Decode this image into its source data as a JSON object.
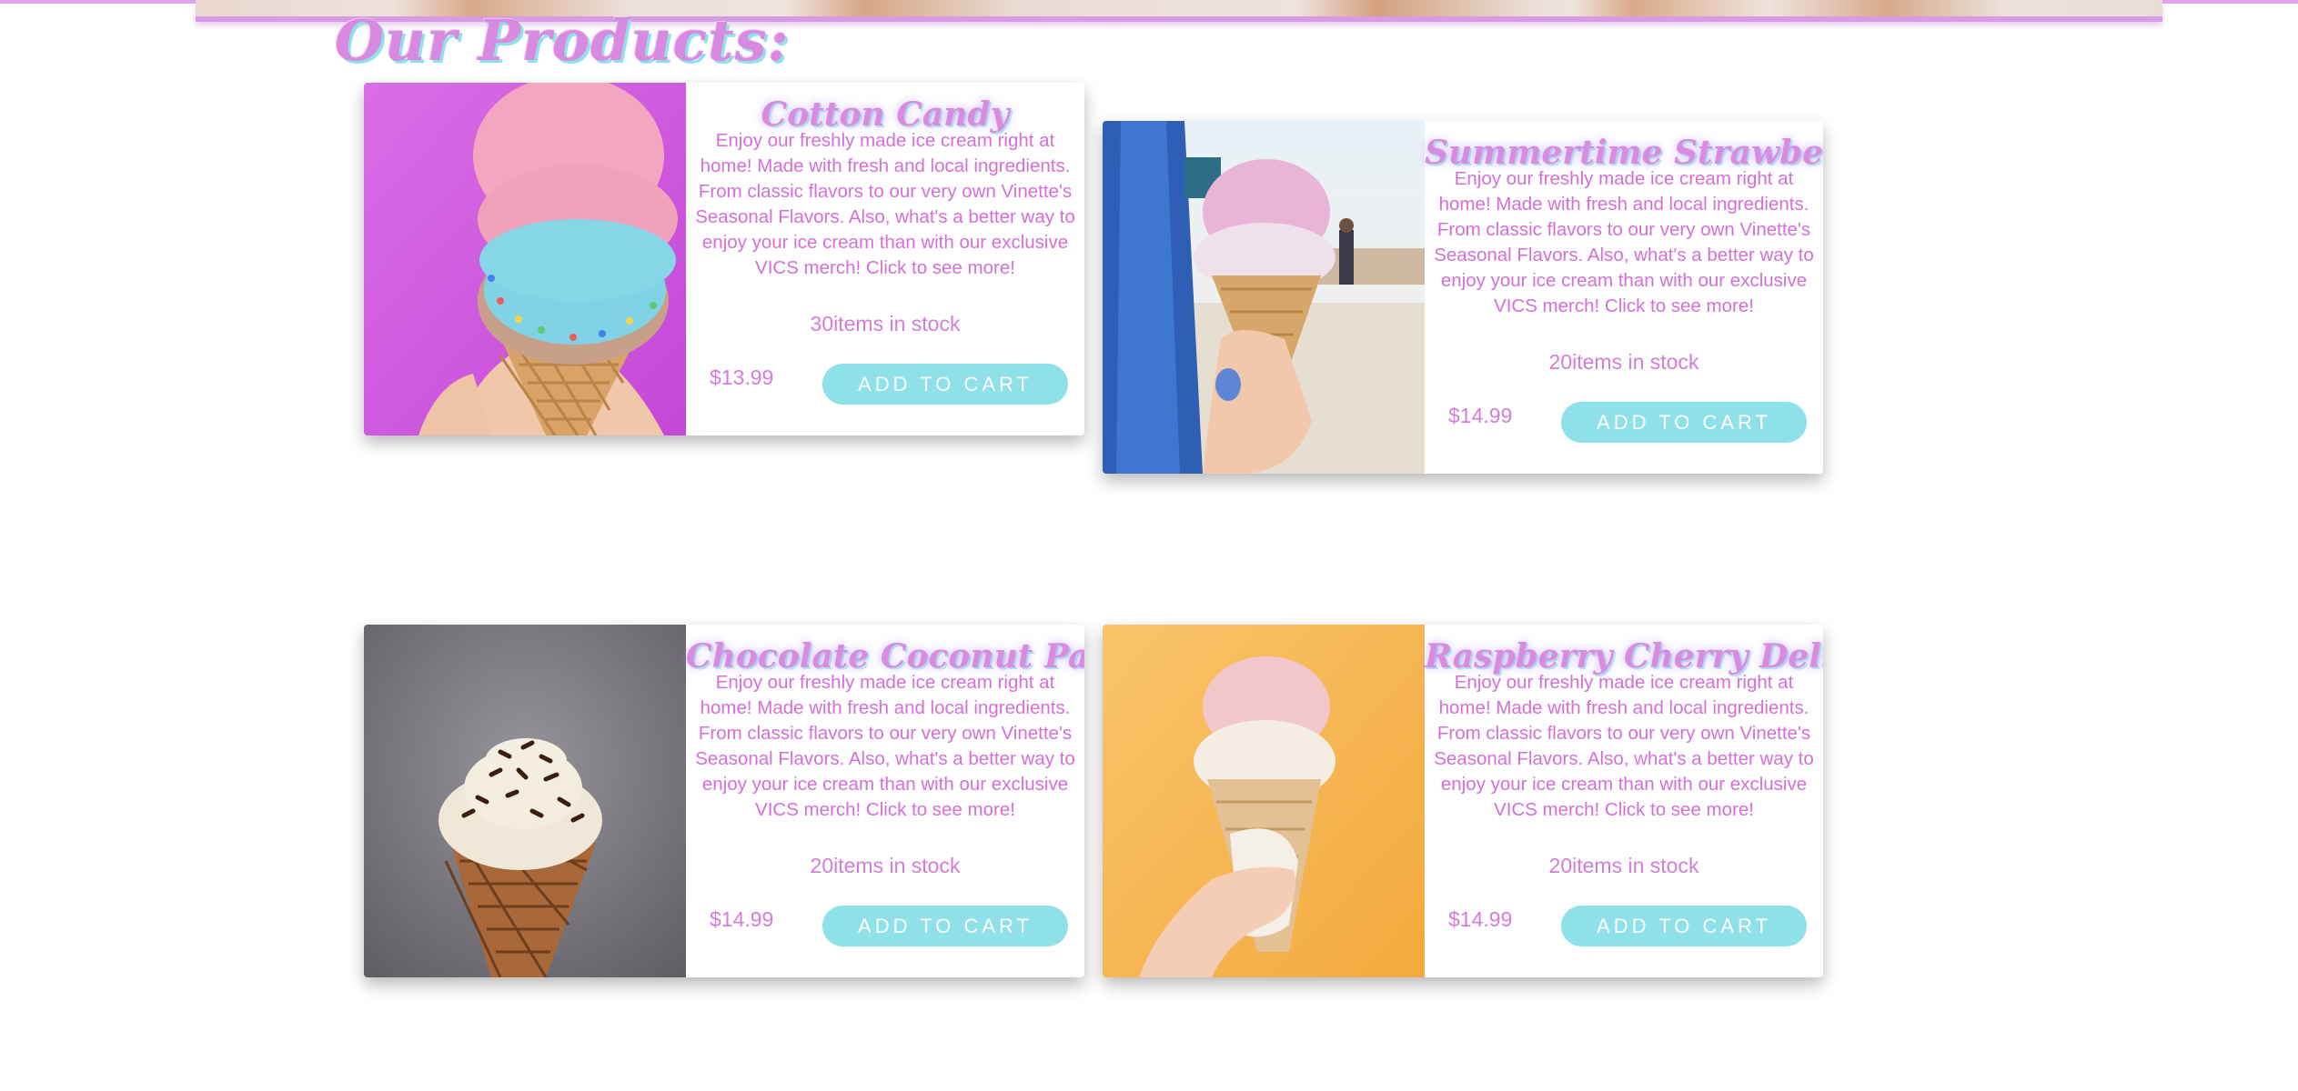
{
  "section": {
    "title": "Our Products:"
  },
  "colors": {
    "accent_pink": "#d98be0",
    "accent_cyan": "#8ee1e8",
    "text_pink": "#d46fd8"
  },
  "products": [
    {
      "name": "Cotton Candy",
      "description": "Enjoy our freshly made ice cream right at home! Made with fresh and local ingredients. From classic flavors to our very own Vinette's Seasonal Flavors. Also, what's a better way to enjoy your ice cream than with our exclusive VICS merch! Click to see more!",
      "stock": "30items in stock",
      "price": "$13.99",
      "button": "ADD TO CART",
      "image": "pink-and-blue-ice-cream-cone-photo"
    },
    {
      "name": "Summertime Strawberry",
      "description": "Enjoy our freshly made ice cream right at home! Made with fresh and local ingredients. From classic flavors to our very own Vinette's Seasonal Flavors. Also, what's a better way to enjoy your ice cream than with our exclusive VICS merch! Click to see more!",
      "stock": "20items in stock",
      "price": "$14.99",
      "button": "ADD TO CART",
      "image": "boardwalk-ice-cream-cone-photo"
    },
    {
      "name": "Chocolate Coconut Paradise",
      "description": "Enjoy our freshly made ice cream right at home! Made with fresh and local ingredients. From classic flavors to our very own Vinette's Seasonal Flavors. Also, what's a better way to enjoy your ice cream than with our exclusive VICS merch! Click to see more!",
      "stock": "20items in stock",
      "price": "$14.99",
      "button": "ADD TO CART",
      "image": "chocolate-sprinkle-cone-photo"
    },
    {
      "name": "Raspberry Cherry Delight",
      "description": "Enjoy our freshly made ice cream right at home! Made with fresh and local ingredients. From classic flavors to our very own Vinette's Seasonal Flavors. Also, what's a better way to enjoy your ice cream than with our exclusive VICS merch! Click to see more!",
      "stock": "20items in stock",
      "price": "$14.99",
      "button": "ADD TO CART",
      "image": "yellow-background-cone-photo"
    }
  ]
}
